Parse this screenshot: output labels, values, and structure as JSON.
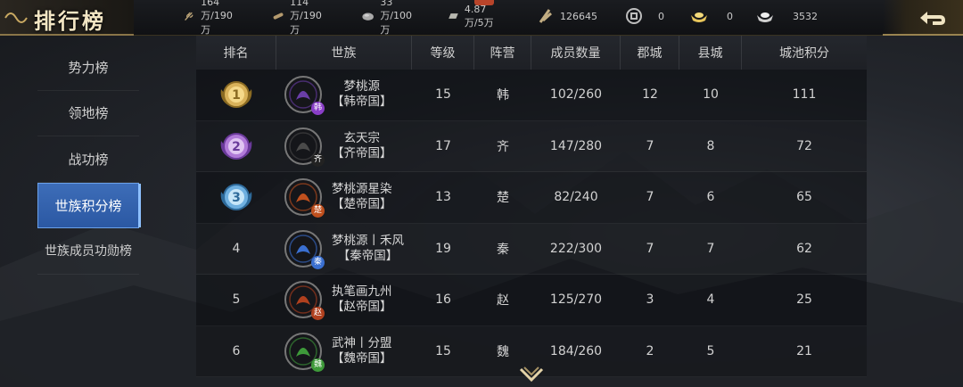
{
  "header": {
    "title": "排行榜",
    "resources": [
      {
        "icon": "grain-icon",
        "value": "164万/190万"
      },
      {
        "icon": "wood-icon",
        "value": "114万/190万"
      },
      {
        "icon": "stone-icon",
        "value": "33万/100万"
      },
      {
        "icon": "iron-icon",
        "value": "4.87万/5万"
      },
      {
        "icon": "order-icon",
        "value": "126645"
      },
      {
        "icon": "copper-coin-icon",
        "value": "0"
      },
      {
        "icon": "gold-ingot-icon",
        "value": "0"
      },
      {
        "icon": "silver-ingot-icon",
        "value": "3532"
      }
    ],
    "back_icon": "return-arrow-icon"
  },
  "sidebar": {
    "items": [
      {
        "label": "势力榜",
        "active": false
      },
      {
        "label": "领地榜",
        "active": false
      },
      {
        "label": "战功榜",
        "active": false
      },
      {
        "label": "世族积分榜",
        "active": true
      },
      {
        "label": "世族成员功勋榜",
        "active": false
      }
    ]
  },
  "table": {
    "columns": [
      "排名",
      "世族",
      "等级",
      "阵营",
      "成员数量",
      "郡城",
      "县城",
      "城池积分"
    ],
    "rows": [
      {
        "rank": "1",
        "medal": "gold",
        "name": "梦桃源",
        "empire": "【韩帝国】",
        "level": "15",
        "camp": "韩",
        "members": "102/260",
        "jun": "12",
        "xian": "10",
        "score": "111",
        "badge_color": "#8a3ec8"
      },
      {
        "rank": "2",
        "medal": "purple",
        "name": "玄天宗",
        "empire": "【齐帝国】",
        "level": "17",
        "camp": "齐",
        "members": "147/280",
        "jun": "7",
        "xian": "8",
        "score": "72",
        "badge_color": "#222222"
      },
      {
        "rank": "3",
        "medal": "blue",
        "name": "梦桃源星染",
        "empire": "【楚帝国】",
        "level": "13",
        "camp": "楚",
        "members": "82/240",
        "jun": "7",
        "xian": "6",
        "score": "65",
        "badge_color": "#c0501e"
      },
      {
        "rank": "4",
        "medal": "",
        "name": "梦桃源丨禾风",
        "empire": "【秦帝国】",
        "level": "19",
        "camp": "秦",
        "members": "222/300",
        "jun": "7",
        "xian": "7",
        "score": "62",
        "badge_color": "#3a6fd0"
      },
      {
        "rank": "5",
        "medal": "",
        "name": "执笔画九州",
        "empire": "【赵帝国】",
        "level": "16",
        "camp": "赵",
        "members": "125/270",
        "jun": "3",
        "xian": "4",
        "score": "25",
        "badge_color": "#b0401e"
      },
      {
        "rank": "6",
        "medal": "",
        "name": "武神丨分盟",
        "empire": "【魏帝国】",
        "level": "15",
        "camp": "魏",
        "members": "184/260",
        "jun": "2",
        "xian": "5",
        "score": "21",
        "badge_color": "#3e9a3a"
      }
    ]
  },
  "colors": {
    "accent_active": "#2b58a3",
    "gold_trim": "#8a7548"
  }
}
